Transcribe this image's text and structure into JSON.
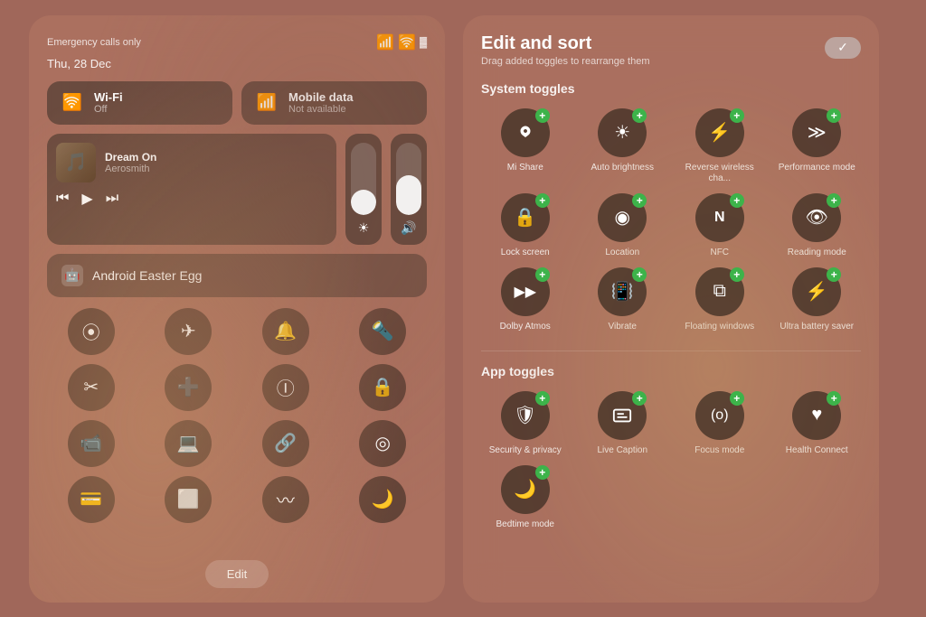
{
  "left": {
    "emergency": "Emergency calls only",
    "date": "Thu, 28 Dec",
    "wifi": {
      "title": "Wi-Fi",
      "subtitle": "Off"
    },
    "mobile": {
      "title": "Mobile data",
      "subtitle": "Not available"
    },
    "media": {
      "song": "Dream On",
      "artist": "Aerosmith"
    },
    "android_btn": "Android Easter Egg",
    "edit_btn": "Edit",
    "icons_row1": [
      "bluetooth",
      "airplane",
      "bell",
      "flashlight"
    ],
    "icons_row2": [
      "scissors",
      "firstaid",
      "circle-i",
      "lock"
    ],
    "icons_row3": [
      "video",
      "screen",
      "link",
      "target"
    ],
    "icons_row4": [
      "card",
      "scan",
      "waves",
      "moon"
    ]
  },
  "right": {
    "title": "Edit and sort",
    "subtitle": "Drag added toggles to rearrange them",
    "system_section": "System toggles",
    "app_section": "App toggles",
    "system_toggles": [
      {
        "icon": "👁",
        "label": "Mi Share"
      },
      {
        "icon": "✦",
        "label": "Auto brightness"
      },
      {
        "icon": "⚡",
        "label": "Reverse wireless cha..."
      },
      {
        "icon": "≫",
        "label": "Performance mode"
      },
      {
        "icon": "🔒",
        "label": "Lock screen"
      },
      {
        "icon": "◉",
        "label": "Location"
      },
      {
        "icon": "N",
        "label": "NFC"
      },
      {
        "icon": "👁",
        "label": "Reading mode"
      },
      {
        "icon": "▶▶",
        "label": "Dolby Atmos"
      },
      {
        "icon": "📳",
        "label": "Vibrate"
      },
      {
        "icon": "⧉",
        "label": "Floating windows"
      },
      {
        "icon": "⚡",
        "label": "Ultra battery saver"
      }
    ],
    "app_toggles": [
      {
        "icon": "🛡",
        "label": "Security & privacy"
      },
      {
        "icon": "◻",
        "label": "Live Caption"
      },
      {
        "icon": "(o)",
        "label": "Focus mode"
      },
      {
        "icon": "♥",
        "label": "Health Connect"
      },
      {
        "icon": "☽",
        "label": "Bedtime mode"
      }
    ]
  }
}
